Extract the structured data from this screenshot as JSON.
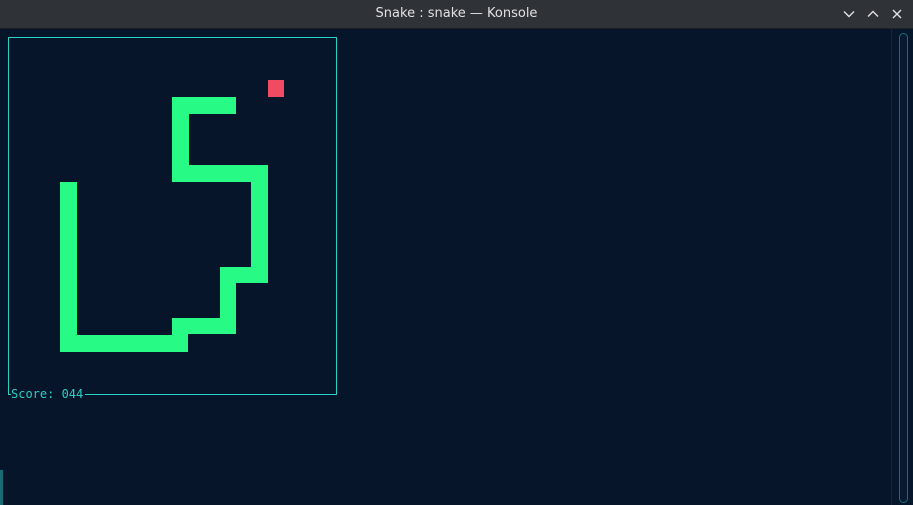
{
  "window": {
    "title": "Snake : snake — Konsole"
  },
  "titlebar_buttons": [
    {
      "name": "minimize-button",
      "icon": "chevron-down-icon"
    },
    {
      "name": "maximize-button",
      "icon": "chevron-up-icon"
    },
    {
      "name": "close-button",
      "icon": "close-icon"
    }
  ],
  "game": {
    "score_label": "Score: 044",
    "colors": {
      "background": "#06152a",
      "border": "#2bd0c4",
      "snake": "#27fb86",
      "food": "#f14a63",
      "score_text": "#2bd0c4"
    }
  }
}
